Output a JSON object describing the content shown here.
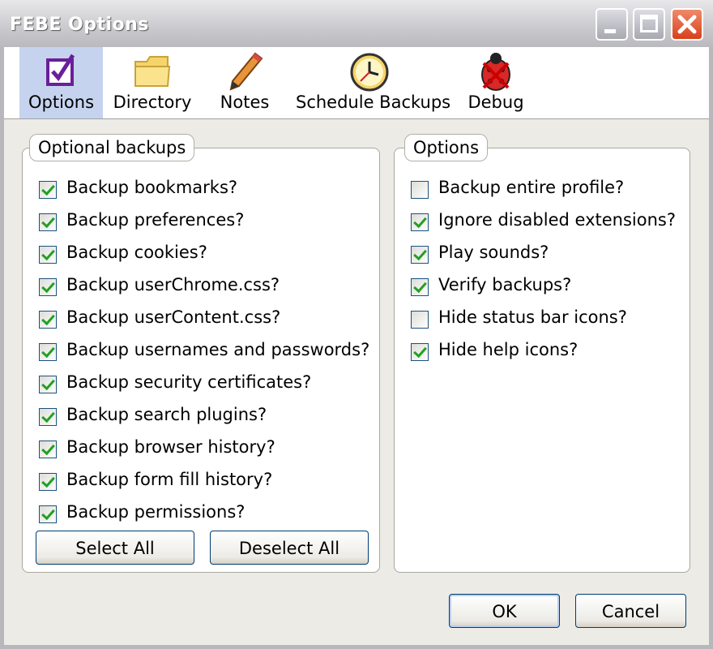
{
  "window": {
    "title": "FEBE Options"
  },
  "toolbar": {
    "tabs": [
      {
        "label": "Options",
        "icon": "checkbox-icon",
        "selected": true
      },
      {
        "label": "Directory",
        "icon": "folder-icon"
      },
      {
        "label": "Notes",
        "icon": "pencil-icon"
      },
      {
        "label": "Schedule Backups",
        "icon": "clock-icon"
      },
      {
        "label": "Debug",
        "icon": "ladybug-icon"
      }
    ]
  },
  "optional_backups": {
    "title": "Optional backups",
    "items": [
      {
        "label": "Backup bookmarks?",
        "checked": true
      },
      {
        "label": "Backup preferences?",
        "checked": true
      },
      {
        "label": "Backup cookies?",
        "checked": true
      },
      {
        "label": "Backup userChrome.css?",
        "checked": true
      },
      {
        "label": "Backup userContent.css?",
        "checked": true
      },
      {
        "label": "Backup usernames and passwords?",
        "checked": true
      },
      {
        "label": "Backup security certificates?",
        "checked": true
      },
      {
        "label": "Backup search plugins?",
        "checked": true
      },
      {
        "label": "Backup browser history?",
        "checked": true
      },
      {
        "label": "Backup form fill history?",
        "checked": true
      },
      {
        "label": "Backup permissions?",
        "checked": true
      }
    ],
    "select_all_label": "Select All",
    "deselect_all_label": "Deselect All"
  },
  "options": {
    "title": "Options",
    "items": [
      {
        "label": "Backup entire profile?",
        "checked": false
      },
      {
        "label": "Ignore disabled extensions?",
        "checked": true
      },
      {
        "label": "Play sounds?",
        "checked": true
      },
      {
        "label": "Verify backups?",
        "checked": true
      },
      {
        "label": "Hide status bar icons?",
        "checked": false
      },
      {
        "label": "Hide help icons?",
        "checked": true
      }
    ]
  },
  "footer": {
    "ok_label": "OK",
    "cancel_label": "Cancel"
  },
  "colors": {
    "check": "#21a121",
    "selected_tab": "#c5d3ee",
    "close_button": "#d8401c"
  }
}
